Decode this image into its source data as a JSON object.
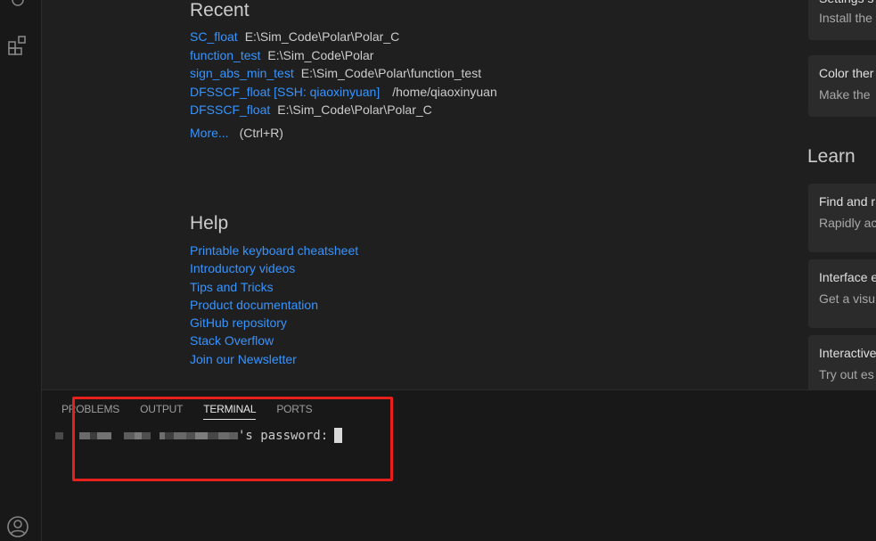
{
  "activity": {
    "icons": [
      "extensions-icon",
      "account-icon"
    ]
  },
  "recent": {
    "title": "Recent",
    "items": [
      {
        "name": "SC_float",
        "path": "E:\\Sim_Code\\Polar\\Polar_C"
      },
      {
        "name": "function_test",
        "path": "E:\\Sim_Code\\Polar"
      },
      {
        "name": "sign_abs_min_test",
        "path": "E:\\Sim_Code\\Polar\\function_test"
      },
      {
        "name": "DFSSCF_float [SSH: qiaoxinyuan]",
        "path": "/home/qiaoxinyuan"
      },
      {
        "name": "DFSSCF_float",
        "path": "E:\\Sim_Code\\Polar\\Polar_C"
      }
    ],
    "more_label": "More...",
    "more_hint": "(Ctrl+R)"
  },
  "help": {
    "title": "Help",
    "items": [
      "Printable keyboard cheatsheet",
      "Introductory videos",
      "Tips and Tricks",
      "Product documentation",
      "GitHub repository",
      "Stack Overflow",
      "Join our Newsletter"
    ]
  },
  "right": {
    "top_cards": [
      {
        "title": "Settings s",
        "desc": "Install the"
      },
      {
        "title": "Color ther",
        "desc": "Make the"
      }
    ],
    "learn_title": "Learn",
    "learn_cards": [
      {
        "title": "Find and r",
        "desc": "Rapidly ac"
      },
      {
        "title": "Interface e",
        "desc": "Get a visu"
      },
      {
        "title": "Interactive",
        "desc": "Try out es"
      }
    ]
  },
  "panel": {
    "tabs": [
      "PROBLEMS",
      "OUTPUT",
      "TERMINAL",
      "PORTS"
    ],
    "active_tab": "TERMINAL",
    "terminal_prompt": "'s password:"
  },
  "colors": {
    "link": "#3794ff",
    "highlight": "#e8201c"
  }
}
